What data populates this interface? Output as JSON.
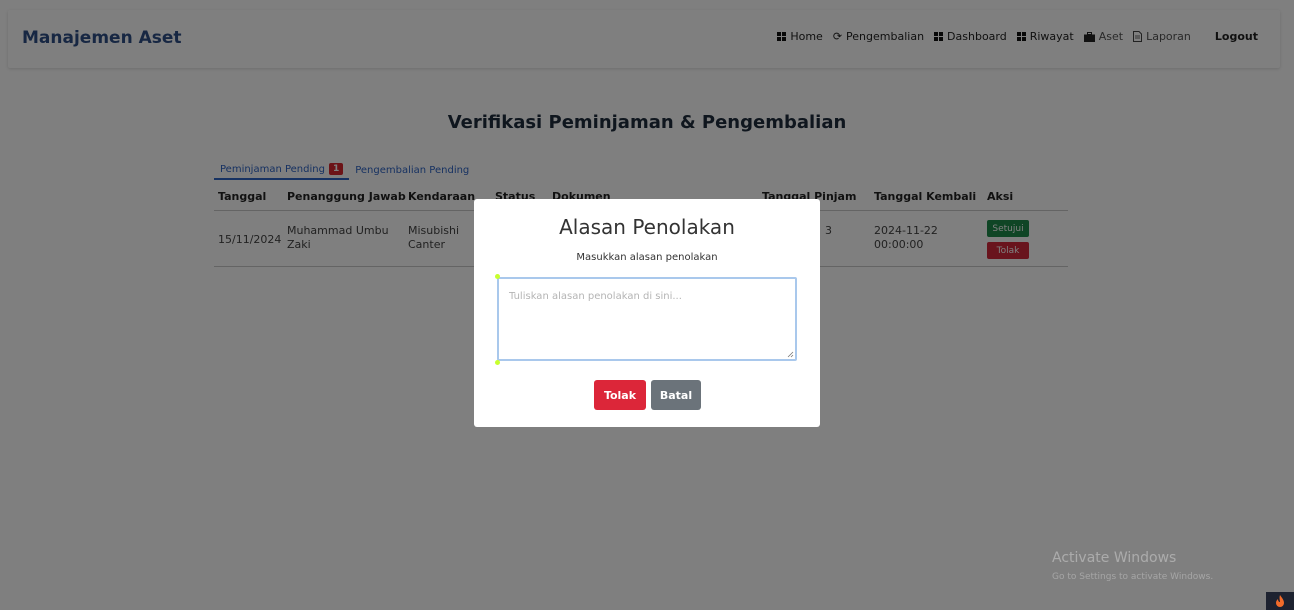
{
  "navbar": {
    "brand": "Manajemen Aset",
    "links": [
      {
        "label": "Home",
        "icon": "grid-icon"
      },
      {
        "label": "Pengembalian",
        "icon": "refresh-icon"
      },
      {
        "label": "Dashboard",
        "icon": "grid-icon"
      },
      {
        "label": "Riwayat",
        "icon": "grid-icon"
      },
      {
        "label": "Aset",
        "icon": "briefcase-icon"
      },
      {
        "label": "Laporan",
        "icon": "document-icon"
      }
    ],
    "logout": "Logout"
  },
  "page": {
    "title": "Verifikasi Peminjaman & Pengembalian",
    "tabs": [
      {
        "label": "Peminjaman Pending",
        "badge": "1"
      },
      {
        "label": "Pengembalian Pending"
      }
    ],
    "table": {
      "headers": [
        "Tanggal",
        "Penanggung Jawab",
        "Kendaraan",
        "Status",
        "Dokumen",
        "Tanggal Pinjam",
        "Tanggal Kembali",
        "Aksi"
      ],
      "row": {
        "tanggal": "15/11/2024",
        "penanggung_jawab_1": "Muhammad Umbu",
        "penanggung_jawab_2": "Zaki",
        "kendaraan_1": "Misubishi",
        "kendaraan_2": "Canter",
        "tanggal_pinjam_partial": "3",
        "tanggal_kembali_1": "2024-11-22",
        "tanggal_kembali_2": "00:00:00",
        "approve_label": "Setujui",
        "reject_label": "Tolak"
      }
    }
  },
  "modal": {
    "title": "Alasan Penolakan",
    "subtitle": "Masukkan alasan penolakan",
    "placeholder": "Tuliskan alasan penolakan di sini...",
    "value": "",
    "reject_button": "Tolak",
    "cancel_button": "Batal"
  },
  "watermark": {
    "line1": "Activate Windows",
    "line2": "Go to Settings to activate Windows."
  },
  "colors": {
    "brand": "#2f4f86",
    "link": "#2f64c4",
    "danger": "#dc2639",
    "success": "#1e8a4a",
    "secondary": "#6b737a"
  }
}
